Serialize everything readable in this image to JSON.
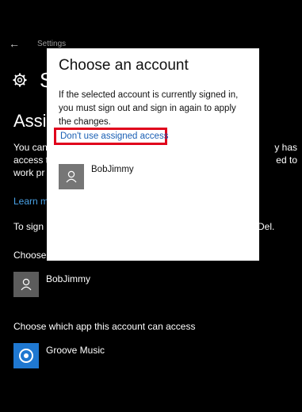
{
  "window": {
    "app_title": "Settings",
    "page_heading_partial": "S",
    "section_heading_partial": "Assig"
  },
  "background": {
    "paragraph_left": [
      "You can",
      "access t",
      "work pr"
    ],
    "paragraph_right": [
      "y has",
      "ed to"
    ],
    "learn_more_partial": "Learn m",
    "signin_partial": "To sign",
    "signin_right": "Del.",
    "choose_partial": "Choose",
    "account_name": "BobJimmy",
    "app_access_label": "Choose which app this account can access",
    "app_name": "Groove Music"
  },
  "dialog": {
    "title": "Choose an account",
    "body_lines": [
      "If the selected account is currently signed in,",
      "you must sign out and sign in again to apply",
      "the changes."
    ],
    "link": "Don't use assigned access",
    "account_name": "BobJimmy"
  },
  "colors": {
    "background": "#000000",
    "dialog_bg": "#ffffff",
    "highlight_border": "#e0001b",
    "link": "#1a5fb4",
    "app_tile": "#1f78d1"
  },
  "icons": [
    "back-arrow-icon",
    "gear-icon",
    "person-icon",
    "groove-music-icon"
  ]
}
